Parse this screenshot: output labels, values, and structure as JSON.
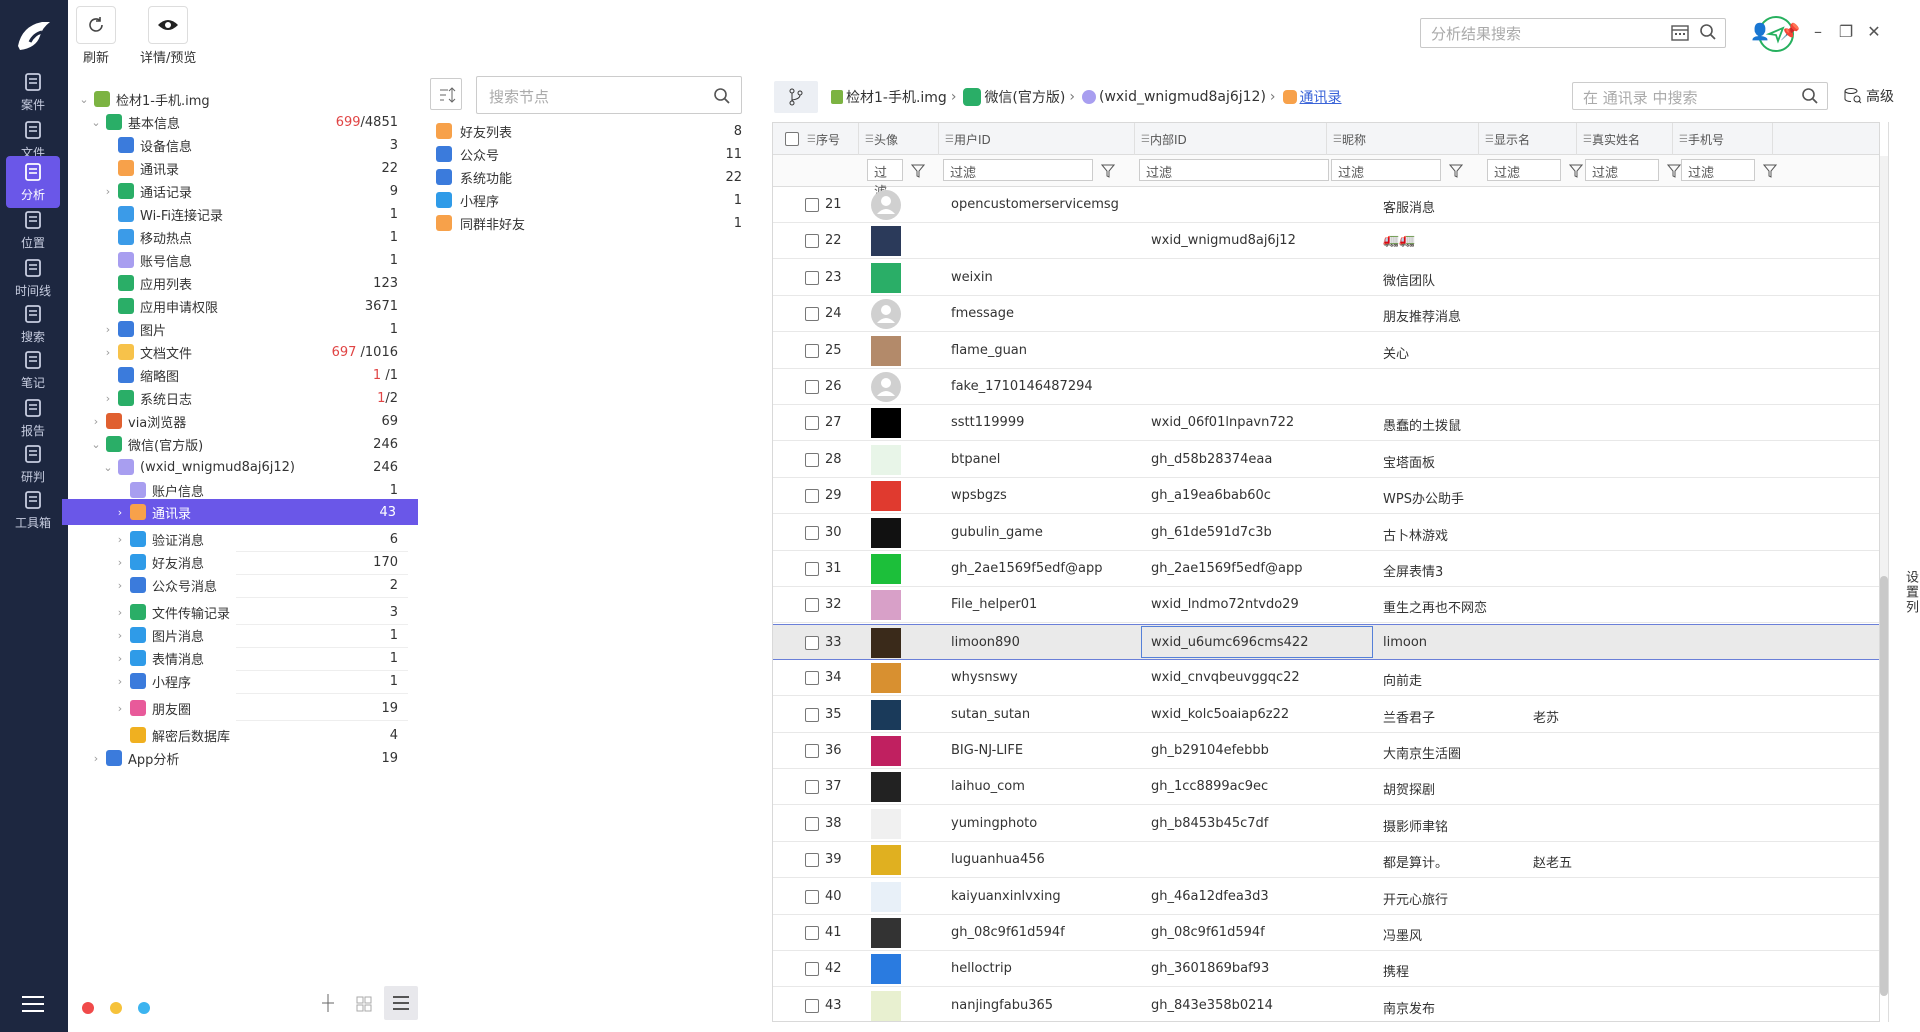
{
  "nav": {
    "items": [
      {
        "label": "案件",
        "icon": "case-icon"
      },
      {
        "label": "文件",
        "icon": "folder-icon"
      },
      {
        "label": "分析",
        "icon": "analysis-icon",
        "active": true
      },
      {
        "label": "位置",
        "icon": "location-icon"
      },
      {
        "label": "时间线",
        "icon": "timeline-icon"
      },
      {
        "label": "搜索",
        "icon": "search-icon"
      },
      {
        "label": "笔记",
        "icon": "note-icon"
      },
      {
        "label": "报告",
        "icon": "report-icon"
      },
      {
        "label": "研判",
        "icon": "judge-icon"
      },
      {
        "label": "工具箱",
        "icon": "toolbox-icon"
      }
    ],
    "active_color": "#6a57e8",
    "bg_color": "#1d2740"
  },
  "toolbar": {
    "refresh_label": "刷新",
    "preview_label": "详情/预览",
    "global_search_placeholder": "分析结果搜索"
  },
  "tree": {
    "rows": [
      {
        "label": "检材1-手机.img",
        "count": ""
      },
      {
        "label": "基本信息",
        "count_red": "699",
        "count": "/4851"
      },
      {
        "label": "设备信息",
        "count": "3"
      },
      {
        "label": "通讯录",
        "count": "22"
      },
      {
        "label": "通话记录",
        "count": "9"
      },
      {
        "label": "Wi-Fi连接记录",
        "count": "1"
      },
      {
        "label": "移动热点",
        "count": "1"
      },
      {
        "label": "账号信息",
        "count": "1"
      },
      {
        "label": "应用列表",
        "count": "123"
      },
      {
        "label": "应用申请权限",
        "count": "3671"
      },
      {
        "label": "图片",
        "count": "1"
      },
      {
        "label": "文档文件",
        "count_red": "697",
        "count": " /1016"
      },
      {
        "label": "缩略图",
        "count_red": "1",
        "count": " /1"
      },
      {
        "label": "系统日志",
        "count_red": "1",
        "count": "/2"
      },
      {
        "label": "via浏览器",
        "count": "69"
      },
      {
        "label": "微信(官方版)",
        "count": "246"
      },
      {
        "label": "(wxid_wnigmud8aj6j12)",
        "count": "246"
      },
      {
        "label": "账户信息",
        "count": "1"
      },
      {
        "label": "通讯录",
        "count": "43"
      },
      {
        "label": "验证消息",
        "count": "6"
      },
      {
        "label": "好友消息",
        "count": "170"
      },
      {
        "label": "公众号消息",
        "count": "2"
      },
      {
        "label": "文件传输记录",
        "count": "3"
      },
      {
        "label": "图片消息",
        "count": "1"
      },
      {
        "label": "表情消息",
        "count": "1"
      },
      {
        "label": "小程序",
        "count": "1"
      },
      {
        "label": "朋友圈",
        "count": "19"
      },
      {
        "label": "解密后数据库",
        "count": "4"
      },
      {
        "label": "App分析",
        "count": "19"
      }
    ]
  },
  "nodes": {
    "search_placeholder": "搜索节点",
    "items": [
      {
        "label": "好友列表",
        "count": "8"
      },
      {
        "label": "公众号",
        "count": "11"
      },
      {
        "label": "系统功能",
        "count": "22"
      },
      {
        "label": "小程序",
        "count": "1"
      },
      {
        "label": "同群非好友",
        "count": "1"
      }
    ]
  },
  "breadcrumb": {
    "img": "检材1-手机.img",
    "app": "微信(官方版)",
    "account": "(wxid_wnigmud8aj6j12)",
    "current": "通讯录"
  },
  "grid_search_placeholder": "在 通讯录 中搜索",
  "advanced_label": "高级",
  "set_columns_label": "设置列",
  "filter_placeholder": "过滤",
  "columns": [
    "序号",
    "头像",
    "用户ID",
    "内部ID",
    "昵称",
    "显示名",
    "真实姓名",
    "手机号"
  ],
  "rows": [
    {
      "num": "21",
      "uid": "opencustomerservicemsg",
      "iid": "",
      "nick": "客服消息",
      "disp": "",
      "av": "#d0d0d0"
    },
    {
      "num": "22",
      "uid": "",
      "iid": "wxid_wnigmud8aj6j12",
      "nick": "🚛🚛",
      "disp": "",
      "av": "#2b3a5a"
    },
    {
      "num": "23",
      "uid": "weixin",
      "iid": "",
      "nick": "微信团队",
      "disp": "",
      "av": "#2aae67"
    },
    {
      "num": "24",
      "uid": "fmessage",
      "iid": "",
      "nick": "朋友推荐消息",
      "disp": "",
      "av": "#d0d0d0"
    },
    {
      "num": "25",
      "uid": "flame_guan",
      "iid": "",
      "nick": "关心",
      "disp": "",
      "av": "#b38a6a"
    },
    {
      "num": "26",
      "uid": "fake_1710146487294",
      "iid": "",
      "nick": "",
      "disp": "",
      "av": "#d0d0d0"
    },
    {
      "num": "27",
      "uid": "sstt119999",
      "iid": "wxid_06f01lnpavn722",
      "nick": "愚蠢的土拨鼠",
      "disp": "",
      "av": "#000000"
    },
    {
      "num": "28",
      "uid": "btpanel",
      "iid": "gh_d58b28374eaa",
      "nick": "宝塔面板",
      "disp": "",
      "av": "#e8f5e8"
    },
    {
      "num": "29",
      "uid": "wpsbgzs",
      "iid": "gh_a19ea6bab60c",
      "nick": "WPS办公助手",
      "disp": "",
      "av": "#e03a2f"
    },
    {
      "num": "30",
      "uid": "gubulin_game",
      "iid": "gh_61de591d7c3b",
      "nick": "古卜林游戏",
      "disp": "",
      "av": "#111111"
    },
    {
      "num": "31",
      "uid": "gh_2ae1569f5edf@app",
      "iid": "gh_2ae1569f5edf@app",
      "nick": "全屏表情3",
      "disp": "",
      "av": "#1cbf3a"
    },
    {
      "num": "32",
      "uid": "File_helper01",
      "iid": "wxid_lndmo72ntvdo29",
      "nick": "重生之再也不网恋",
      "disp": "",
      "av": "#d8a0c8"
    },
    {
      "num": "33",
      "uid": "limoon890",
      "iid": "wxid_u6umc696cms422",
      "nick": "limoon",
      "disp": "",
      "av": "#3a2a1a",
      "selected": true
    },
    {
      "num": "34",
      "uid": "whysnswy",
      "iid": "wxid_cnvqbeuvggqc22",
      "nick": "向前走",
      "disp": "",
      "av": "#d89030"
    },
    {
      "num": "35",
      "uid": "sutan_sutan",
      "iid": "wxid_kolc5oaiap6z22",
      "nick": "兰香君子",
      "disp": "老苏",
      "av": "#1a3a5a"
    },
    {
      "num": "36",
      "uid": "BIG-NJ-LIFE",
      "iid": "gh_b29104efebbb",
      "nick": "大南京生活圈",
      "disp": "",
      "av": "#c02060"
    },
    {
      "num": "37",
      "uid": "laihuo_com",
      "iid": "gh_1cc8899ac9ec",
      "nick": "胡贺探剧",
      "disp": "",
      "av": "#222222"
    },
    {
      "num": "38",
      "uid": "yumingphoto",
      "iid": "gh_b8453b45c7df",
      "nick": "摄影师聿铭",
      "disp": "",
      "av": "#f0f0f0"
    },
    {
      "num": "39",
      "uid": "luguanhua456",
      "iid": "",
      "nick": "都是算计。",
      "disp": "赵老五",
      "av": "#e0b020"
    },
    {
      "num": "40",
      "uid": "kaiyuanxinlvxing",
      "iid": "gh_46a12dfea3d3",
      "nick": "开元心旅行",
      "disp": "",
      "av": "#e8f0f8"
    },
    {
      "num": "41",
      "uid": "gh_08c9f61d594f",
      "iid": "gh_08c9f61d594f",
      "nick": "冯墨风",
      "disp": "",
      "av": "#333333"
    },
    {
      "num": "42",
      "uid": "helloctrip",
      "iid": "gh_3601869baf93",
      "nick": "携程",
      "disp": "",
      "av": "#2a7be0"
    },
    {
      "num": "43",
      "uid": "nanjingfabu365",
      "iid": "gh_843e358b0214",
      "nick": "南京发布",
      "disp": "",
      "av": "#e8f0d0"
    }
  ]
}
